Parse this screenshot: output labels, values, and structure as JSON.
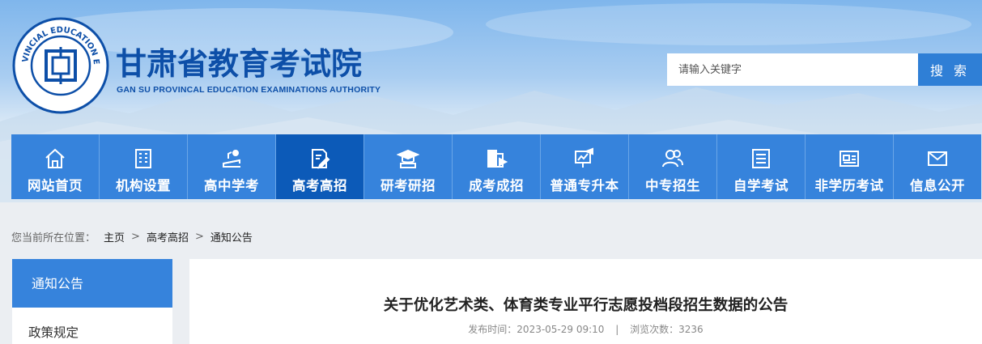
{
  "header": {
    "title": "甘肃省教育考试院",
    "subtitle": "GAN SU PROVINCAL EDUCATION EXAMINATIONS AUTHORITY",
    "logo_text": "甘肃省教育考试院 GANSU PROVINCIAL EDUCATION EXAMINATIONS AUTHORITY"
  },
  "search": {
    "placeholder": "请输入关键字",
    "button_label": "搜 索"
  },
  "nav": {
    "items": [
      {
        "label": "网站首页",
        "icon": "home-icon"
      },
      {
        "label": "机构设置",
        "icon": "building-icon"
      },
      {
        "label": "高中学考",
        "icon": "books-icon"
      },
      {
        "label": "高考高招",
        "icon": "document-pen-icon"
      },
      {
        "label": "研考研招",
        "icon": "graduation-cap-icon"
      },
      {
        "label": "成考成招",
        "icon": "book-icon"
      },
      {
        "label": "普通专升本",
        "icon": "presentation-board-icon"
      },
      {
        "label": "中专招生",
        "icon": "users-icon"
      },
      {
        "label": "自学考试",
        "icon": "list-document-icon"
      },
      {
        "label": "非学历考试",
        "icon": "id-card-icon"
      },
      {
        "label": "信息公开",
        "icon": "mail-icon"
      }
    ],
    "active_index": 3
  },
  "breadcrumb": {
    "prefix": "您当前所在位置：",
    "items": [
      "主页",
      "高考高招",
      "通知公告"
    ],
    "separator": ">"
  },
  "sidebar": {
    "items": [
      "通知公告",
      "政策规定"
    ]
  },
  "article": {
    "title": "关于优化艺术类、体育类专业平行志愿投档段招生数据的公告",
    "publish_label": "发布时间：",
    "publish_time": "2023-05-29 09:10",
    "meta_separator": "|",
    "views_label": "浏览次数：",
    "views": "3236"
  },
  "colors": {
    "brand_blue": "#0d4fa8",
    "nav_blue": "#3683dc",
    "nav_active": "#0c5ab8",
    "search_button": "#2f7fd6"
  }
}
